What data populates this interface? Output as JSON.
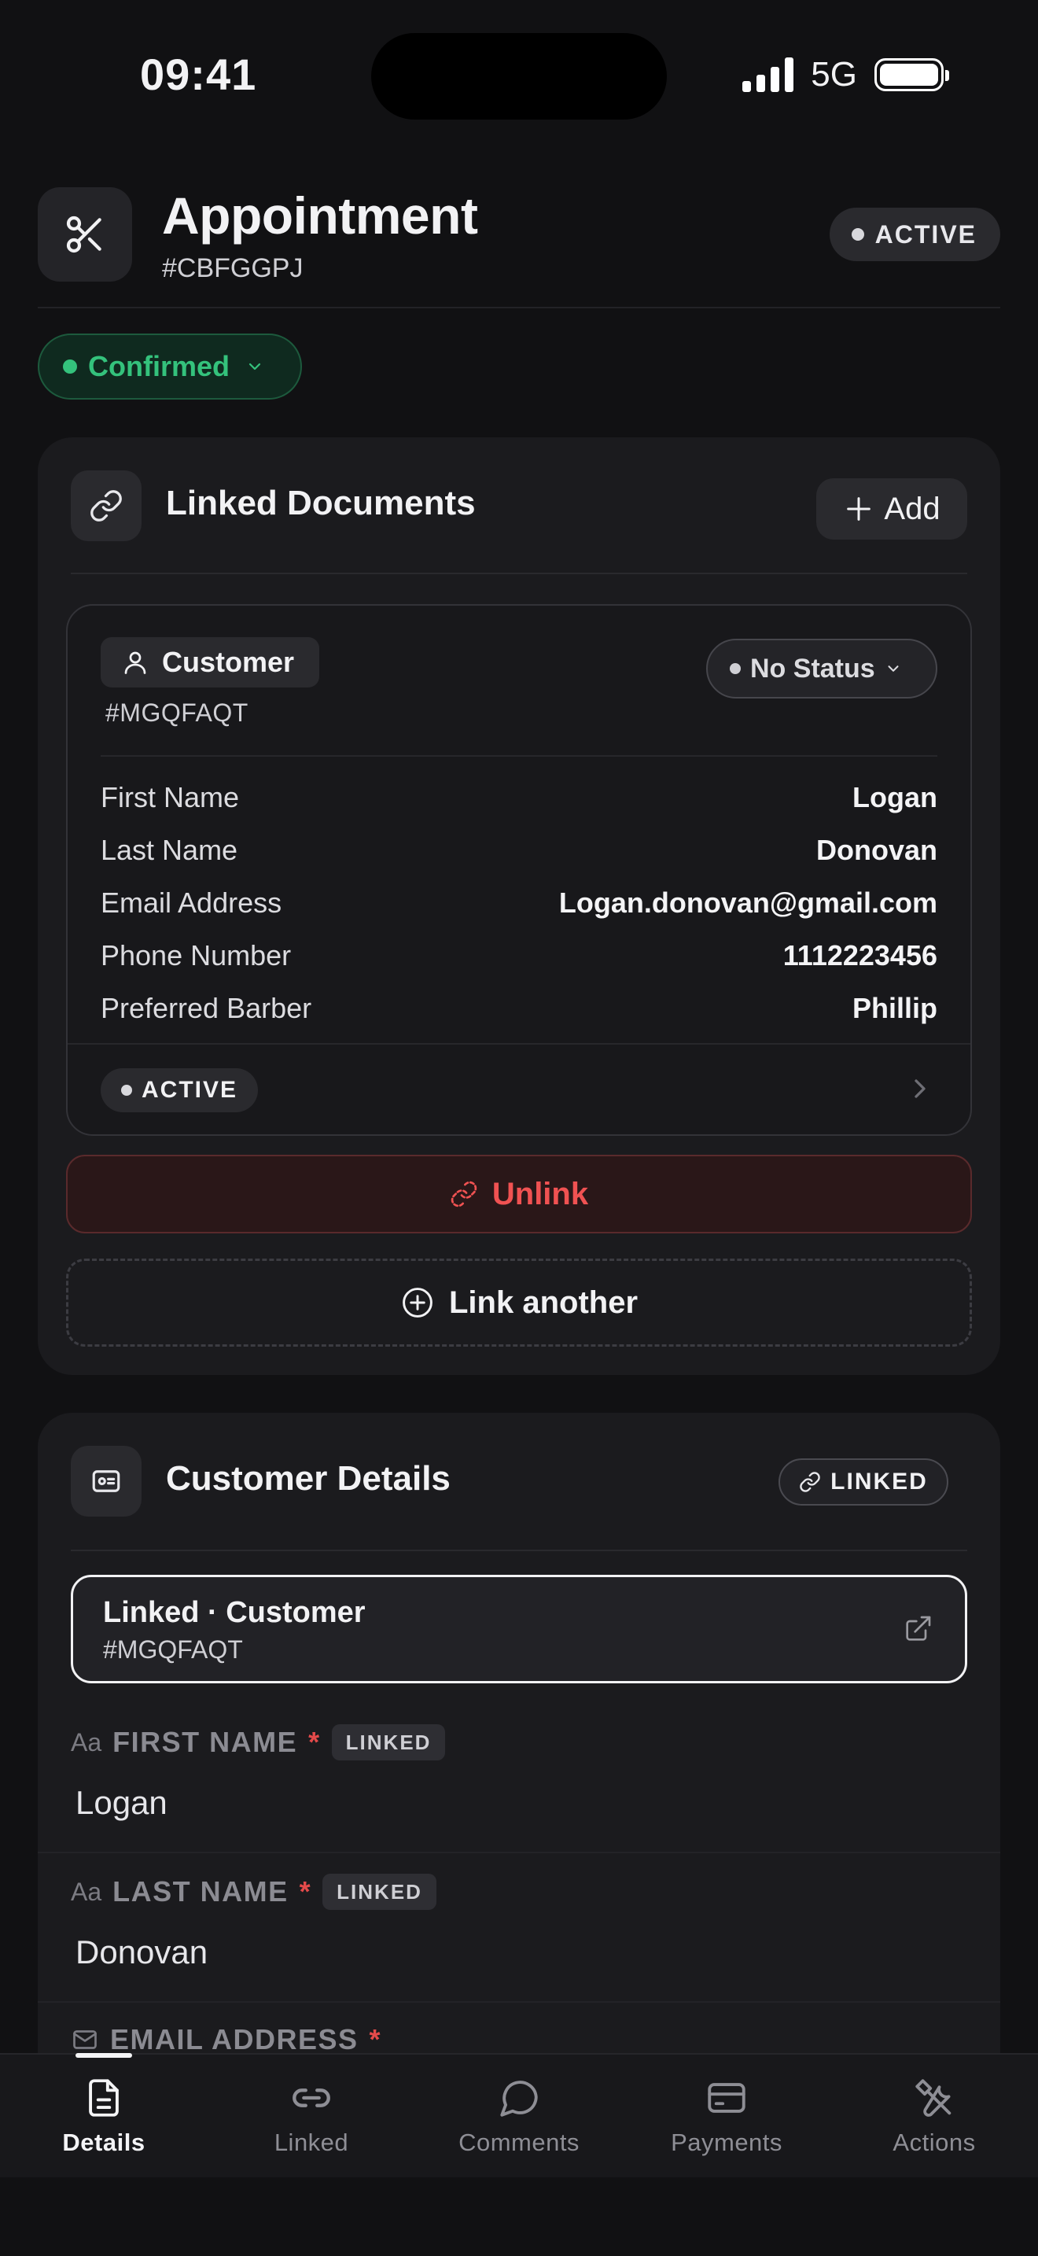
{
  "status_bar": {
    "time": "09:41",
    "network": "5G"
  },
  "header": {
    "title": "Appointment",
    "id": "#CBFGGPJ",
    "badge": "ACTIVE",
    "icon": "scissors-icon"
  },
  "stage": {
    "label": "Confirmed",
    "color": "#34c27c"
  },
  "linked_documents": {
    "title": "Linked Documents",
    "add_label": "Add",
    "document": {
      "type": "Customer",
      "id": "#MGQFAQT",
      "status": "No Status",
      "fields": [
        {
          "label": "First Name",
          "value": "Logan"
        },
        {
          "label": "Last Name",
          "value": "Donovan"
        },
        {
          "label": "Email Address",
          "value": "Logan.donovan@gmail.com"
        },
        {
          "label": "Phone Number",
          "value": "1112223456"
        },
        {
          "label": "Preferred Barber",
          "value": "Phillip"
        }
      ],
      "footer_badge": "ACTIVE"
    },
    "unlink_label": "Unlink",
    "link_another_label": "Link another"
  },
  "customer_details": {
    "title": "Customer Details",
    "badge": "LINKED",
    "linked_title": "Linked · Customer",
    "linked_id": "#MGQFAQT",
    "fields": [
      {
        "icon_text": "Aa",
        "label": "FIRST NAME",
        "required": "*",
        "tag": "LINKED",
        "value": "Logan"
      },
      {
        "icon_text": "Aa",
        "label": "LAST NAME",
        "required": "*",
        "tag": "LINKED",
        "value": "Donovan"
      },
      {
        "icon": "mail-icon",
        "label": "EMAIL ADDRESS",
        "required": "*"
      }
    ]
  },
  "tabs": [
    {
      "label": "Details",
      "icon": "document-icon",
      "active": true
    },
    {
      "label": "Linked",
      "icon": "link-icon"
    },
    {
      "label": "Comments",
      "icon": "chat-icon"
    },
    {
      "label": "Payments",
      "icon": "card-icon"
    },
    {
      "label": "Actions",
      "icon": "tools-icon"
    }
  ],
  "colors": {
    "background": "#111113",
    "card": "#1b1b1e",
    "danger": "#f05252",
    "success": "#34c27c"
  }
}
